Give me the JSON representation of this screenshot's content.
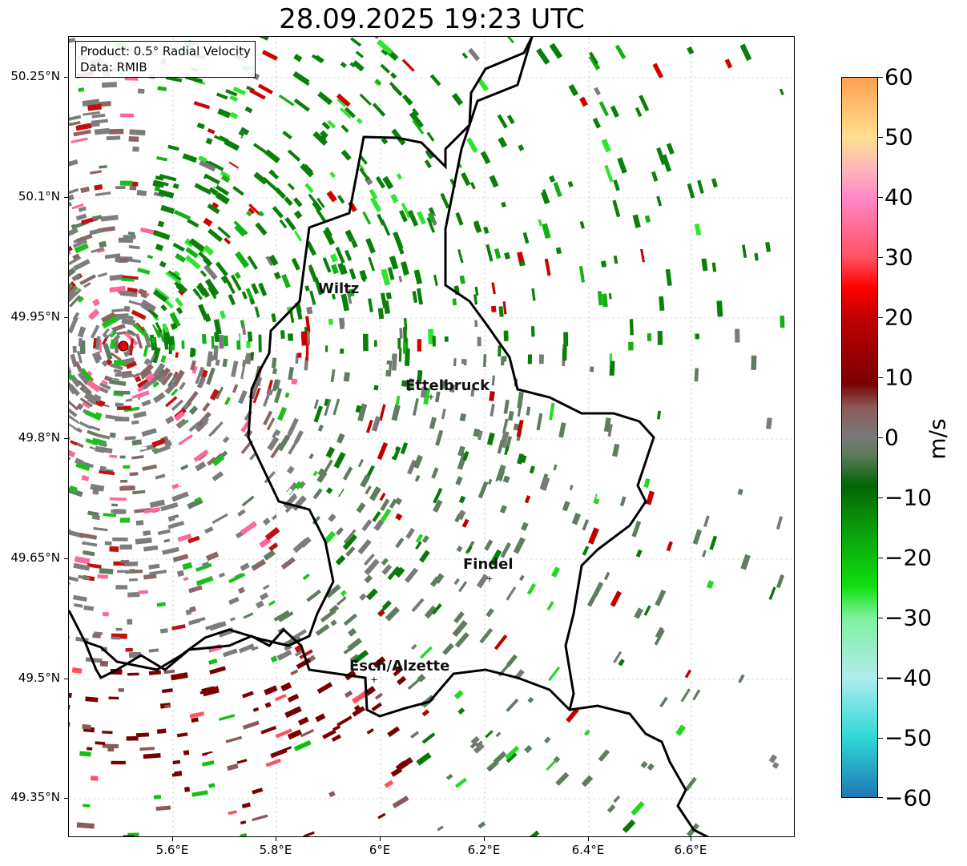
{
  "title": "28.09.2025 19:23 UTC",
  "info": {
    "product": "Product: 0.5° Radial Velocity",
    "data": "Data: RMIB"
  },
  "axes": {
    "lat_ticks": [
      "50.25°N",
      "50.1°N",
      "49.95°N",
      "49.8°N",
      "49.65°N",
      "49.5°N",
      "49.35°N"
    ],
    "lon_ticks": [
      "5.6°E",
      "5.8°E",
      "6°E",
      "6.2°E",
      "6.4°E",
      "6.6°E"
    ]
  },
  "colorbar": {
    "label": "m/s",
    "ticks": [
      "60",
      "50",
      "40",
      "30",
      "20",
      "10",
      "0",
      "−10",
      "−20",
      "−30",
      "−40",
      "−50",
      "−60"
    ],
    "range": [
      -60,
      60
    ],
    "colors": {
      "-60": "#1f78b4",
      "-50": "#2ed8d8",
      "-40": "#b0ecec",
      "-30": "#7ef0a0",
      "-25": "#10e010",
      "-15": "#0a9a0a",
      "-8": "#036403",
      "-3": "#5a7a5a",
      "0": "#7a7a7a",
      "5": "#8a5a5a",
      "9": "#7a0000",
      "20": "#c00000",
      "25": "#ff0000",
      "30": "#ff5060",
      "40": "#ff88c8",
      "45": "#ffb8b8",
      "50": "#ffe090",
      "60": "#ffa050"
    }
  },
  "cities": [
    {
      "name": "Wiltz"
    },
    {
      "name": "Ettelbruck"
    },
    {
      "name": "Findel"
    },
    {
      "name": "Esch/Alzette"
    }
  ]
}
